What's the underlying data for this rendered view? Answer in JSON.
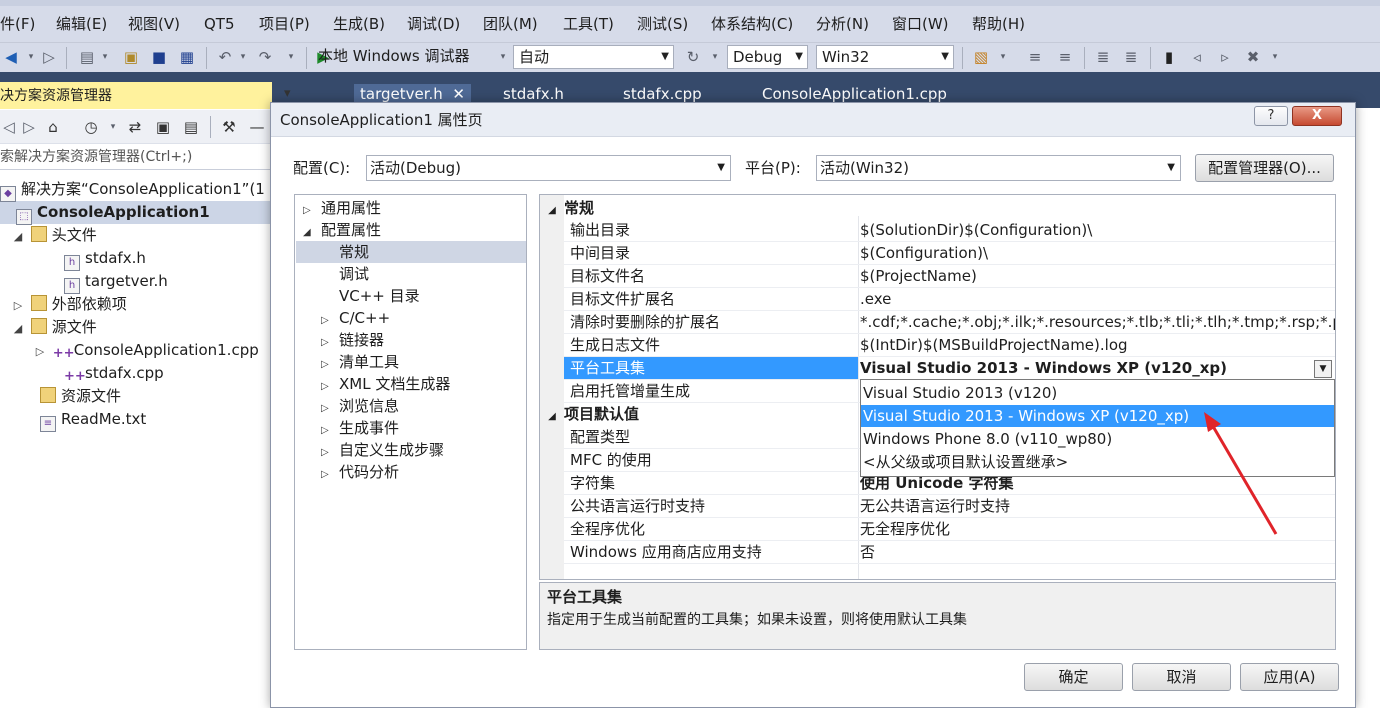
{
  "menu": [
    "件(F)",
    "编辑(E)",
    "视图(V)",
    "QT5",
    "项目(P)",
    "生成(B)",
    "调试(D)",
    "团队(M)",
    "工具(T)",
    "测试(S)",
    "体系结构(C)",
    "分析(N)",
    "窗口(W)",
    "帮助(H)"
  ],
  "toolbar": {
    "run_label": "本地 Windows 调试器",
    "solution_config": "自动",
    "build_config": "Debug",
    "platform": "Win32"
  },
  "doc_tabs": [
    "targetver.h",
    "stdafx.h",
    "stdafx.cpp",
    "ConsoleApplication1.cpp"
  ],
  "solution_explorer": {
    "title": "决方案资源管理器",
    "search_placeholder": "索解决方案资源管理器(Ctrl+;)",
    "tree": [
      {
        "label": "解决方案“ConsoleApplication1”(1"
      },
      {
        "label": "ConsoleApplication1"
      },
      {
        "label": "头文件"
      },
      {
        "label": "stdafx.h"
      },
      {
        "label": "targetver.h"
      },
      {
        "label": "外部依赖项"
      },
      {
        "label": "源文件"
      },
      {
        "label": "ConsoleApplication1.cpp"
      },
      {
        "label": "stdafx.cpp"
      },
      {
        "label": "资源文件"
      },
      {
        "label": "ReadMe.txt"
      }
    ]
  },
  "dialog": {
    "title": "ConsoleApplication1 属性页",
    "help_label": "?",
    "close_label": "X",
    "config_label": "配置(C):",
    "config_value": "活动(Debug)",
    "platform_label": "平台(P):",
    "platform_value": "活动(Win32)",
    "config_manager": "配置管理器(O)...",
    "nav": [
      {
        "label": "通用属性"
      },
      {
        "label": "配置属性"
      },
      {
        "label": "常规"
      },
      {
        "label": "调试"
      },
      {
        "label": "VC++ 目录"
      },
      {
        "label": "C/C++"
      },
      {
        "label": "链接器"
      },
      {
        "label": "清单工具"
      },
      {
        "label": "XML 文档生成器"
      },
      {
        "label": "浏览信息"
      },
      {
        "label": "生成事件"
      },
      {
        "label": "自定义生成步骤"
      },
      {
        "label": "代码分析"
      }
    ],
    "grid": {
      "cat_general": "常规",
      "cat_defaults": "项目默认值",
      "rows": [
        {
          "name": "输出目录",
          "value": "$(SolutionDir)$(Configuration)\\"
        },
        {
          "name": "中间目录",
          "value": "$(Configuration)\\"
        },
        {
          "name": "目标文件名",
          "value": "$(ProjectName)"
        },
        {
          "name": "目标文件扩展名",
          "value": ".exe"
        },
        {
          "name": "清除时要删除的扩展名",
          "value": "*.cdf;*.cache;*.obj;*.ilk;*.resources;*.tlb;*.tli;*.tlh;*.tmp;*.rsp;*.pgc"
        },
        {
          "name": "生成日志文件",
          "value": "$(IntDir)$(MSBuildProjectName).log"
        },
        {
          "name": "平台工具集",
          "value": "Visual Studio 2013 - Windows XP (v120_xp)"
        },
        {
          "name": "启用托管增量生成",
          "value": ""
        },
        {
          "name": "配置类型",
          "value": ""
        },
        {
          "name": "MFC 的使用",
          "value": ""
        },
        {
          "name": "字符集",
          "value": "使用 Unicode 字符集"
        },
        {
          "name": "公共语言运行时支持",
          "value": "无公共语言运行时支持"
        },
        {
          "name": "全程序优化",
          "value": "无全程序优化"
        },
        {
          "name": "Windows 应用商店应用支持",
          "value": "否"
        }
      ],
      "dropdown_options": [
        "Visual Studio 2013 (v120)",
        "Visual Studio 2013 - Windows XP (v120_xp)",
        "Windows Phone 8.0 (v110_wp80)",
        "<从父级或项目默认设置继承>"
      ]
    },
    "description": {
      "title": "平台工具集",
      "text": "指定用于生成当前配置的工具集；如果未设置，则将使用默认工具集"
    },
    "buttons": {
      "ok": "确定",
      "cancel": "取消",
      "apply": "应用(A)"
    }
  },
  "colors": {
    "selection": "#3399ff",
    "tab_bar": "#364a6b",
    "se_header": "#fff29d",
    "annotation_arrow": "#e0242a"
  }
}
